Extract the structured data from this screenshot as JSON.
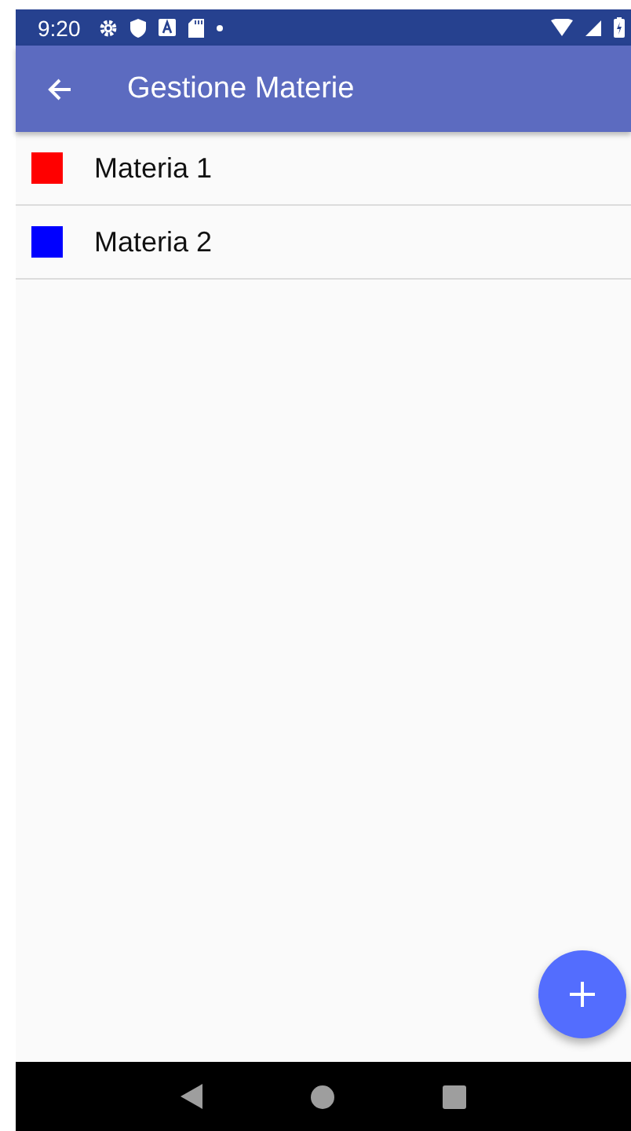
{
  "status_bar": {
    "time": "9:20"
  },
  "app_bar": {
    "title": "Gestione Materie"
  },
  "subjects": [
    {
      "name": "Materia 1",
      "color": "#ff0000"
    },
    {
      "name": "Materia 2",
      "color": "#0000ff"
    }
  ]
}
